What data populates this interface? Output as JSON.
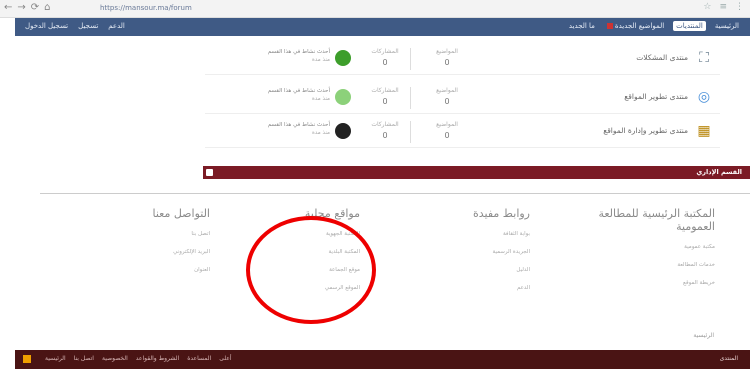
{
  "browser": {
    "nav_icons": [
      "←",
      "→",
      "⟳",
      "⌂"
    ],
    "url": "https://mansour.ma/forum",
    "tool_icons": [
      "☆",
      "≡",
      "⋮"
    ]
  },
  "topnav": {
    "left": [
      "تسجيل الدخول",
      "تسجيل",
      "الدعم"
    ],
    "right": [
      {
        "label": "المنتديات",
        "active": true
      },
      {
        "label": "الرئيسية",
        "active": false
      },
      {
        "label": "المواضيع الجديدة",
        "active": false
      },
      {
        "label": "ما الجديد",
        "active": false
      }
    ],
    "accent": "#3f5a85"
  },
  "forums": [
    {
      "name": "منتدى المشكلات",
      "icon": "organization-icon",
      "glyph": "⛶",
      "stat1_label": "المواضيع",
      "stat1_value": "0",
      "stat2_label": "المشاركات",
      "stat2_value": "0",
      "last_title": "أحدث نشاط في هذا القسم",
      "last_meta": "منذ مدة",
      "avatar_color": "#3d9e2b"
    },
    {
      "name": "منتدى تطوير المواقع",
      "icon": "globe-icon",
      "glyph": "◎",
      "stat1_label": "المواضيع",
      "stat1_value": "0",
      "stat2_label": "المشاركات",
      "stat2_value": "0",
      "last_title": "أحدث نشاط في هذا القسم",
      "last_meta": "منذ مدة",
      "avatar_color": "#8cd17a"
    },
    {
      "name": "منتدى تطوير وإدارة المواقع",
      "icon": "building-icon",
      "glyph": "▦",
      "stat1_label": "المواضيع",
      "stat1_value": "0",
      "stat2_label": "المشاركات",
      "stat2_value": "0",
      "last_title": "أحدث نشاط في هذا القسم",
      "last_meta": "منذ مدة",
      "avatar_color": "#222222"
    }
  ],
  "category_bar": {
    "title": "القسم الإداري",
    "subtitle": "",
    "color": "#7b1b25"
  },
  "footer_columns": [
    {
      "heading": "المكتبة الرئيسية للمطالعة العمومية",
      "items": [
        "مكتبة عمومية",
        "خدمات المطالعة",
        "خريطة الموقع"
      ]
    },
    {
      "heading": "روابط مفيدة",
      "items": [
        "بوابة الثقافة",
        "الجريدة الرسمية",
        "الدليل",
        "الدعم"
      ]
    },
    {
      "heading": "مواقع محلية",
      "items": [
        "المكتبة الجهوية",
        "المكتبة البلدية",
        "موقع الجماعة",
        "الموقع الرسمي"
      ]
    },
    {
      "heading": "التواصل معنا",
      "items": [
        "اتصل بنا",
        "البريد الإلكتروني",
        "العنوان"
      ]
    }
  ],
  "bottom_label": "الرئيسية",
  "footer": {
    "links": [
      "الرئيسية",
      "اتصل بنا",
      "الخصوصية",
      "الشروط والقواعد",
      "المساعدة",
      "أعلى"
    ],
    "right": "المنتدى",
    "color": "#4a1414"
  }
}
